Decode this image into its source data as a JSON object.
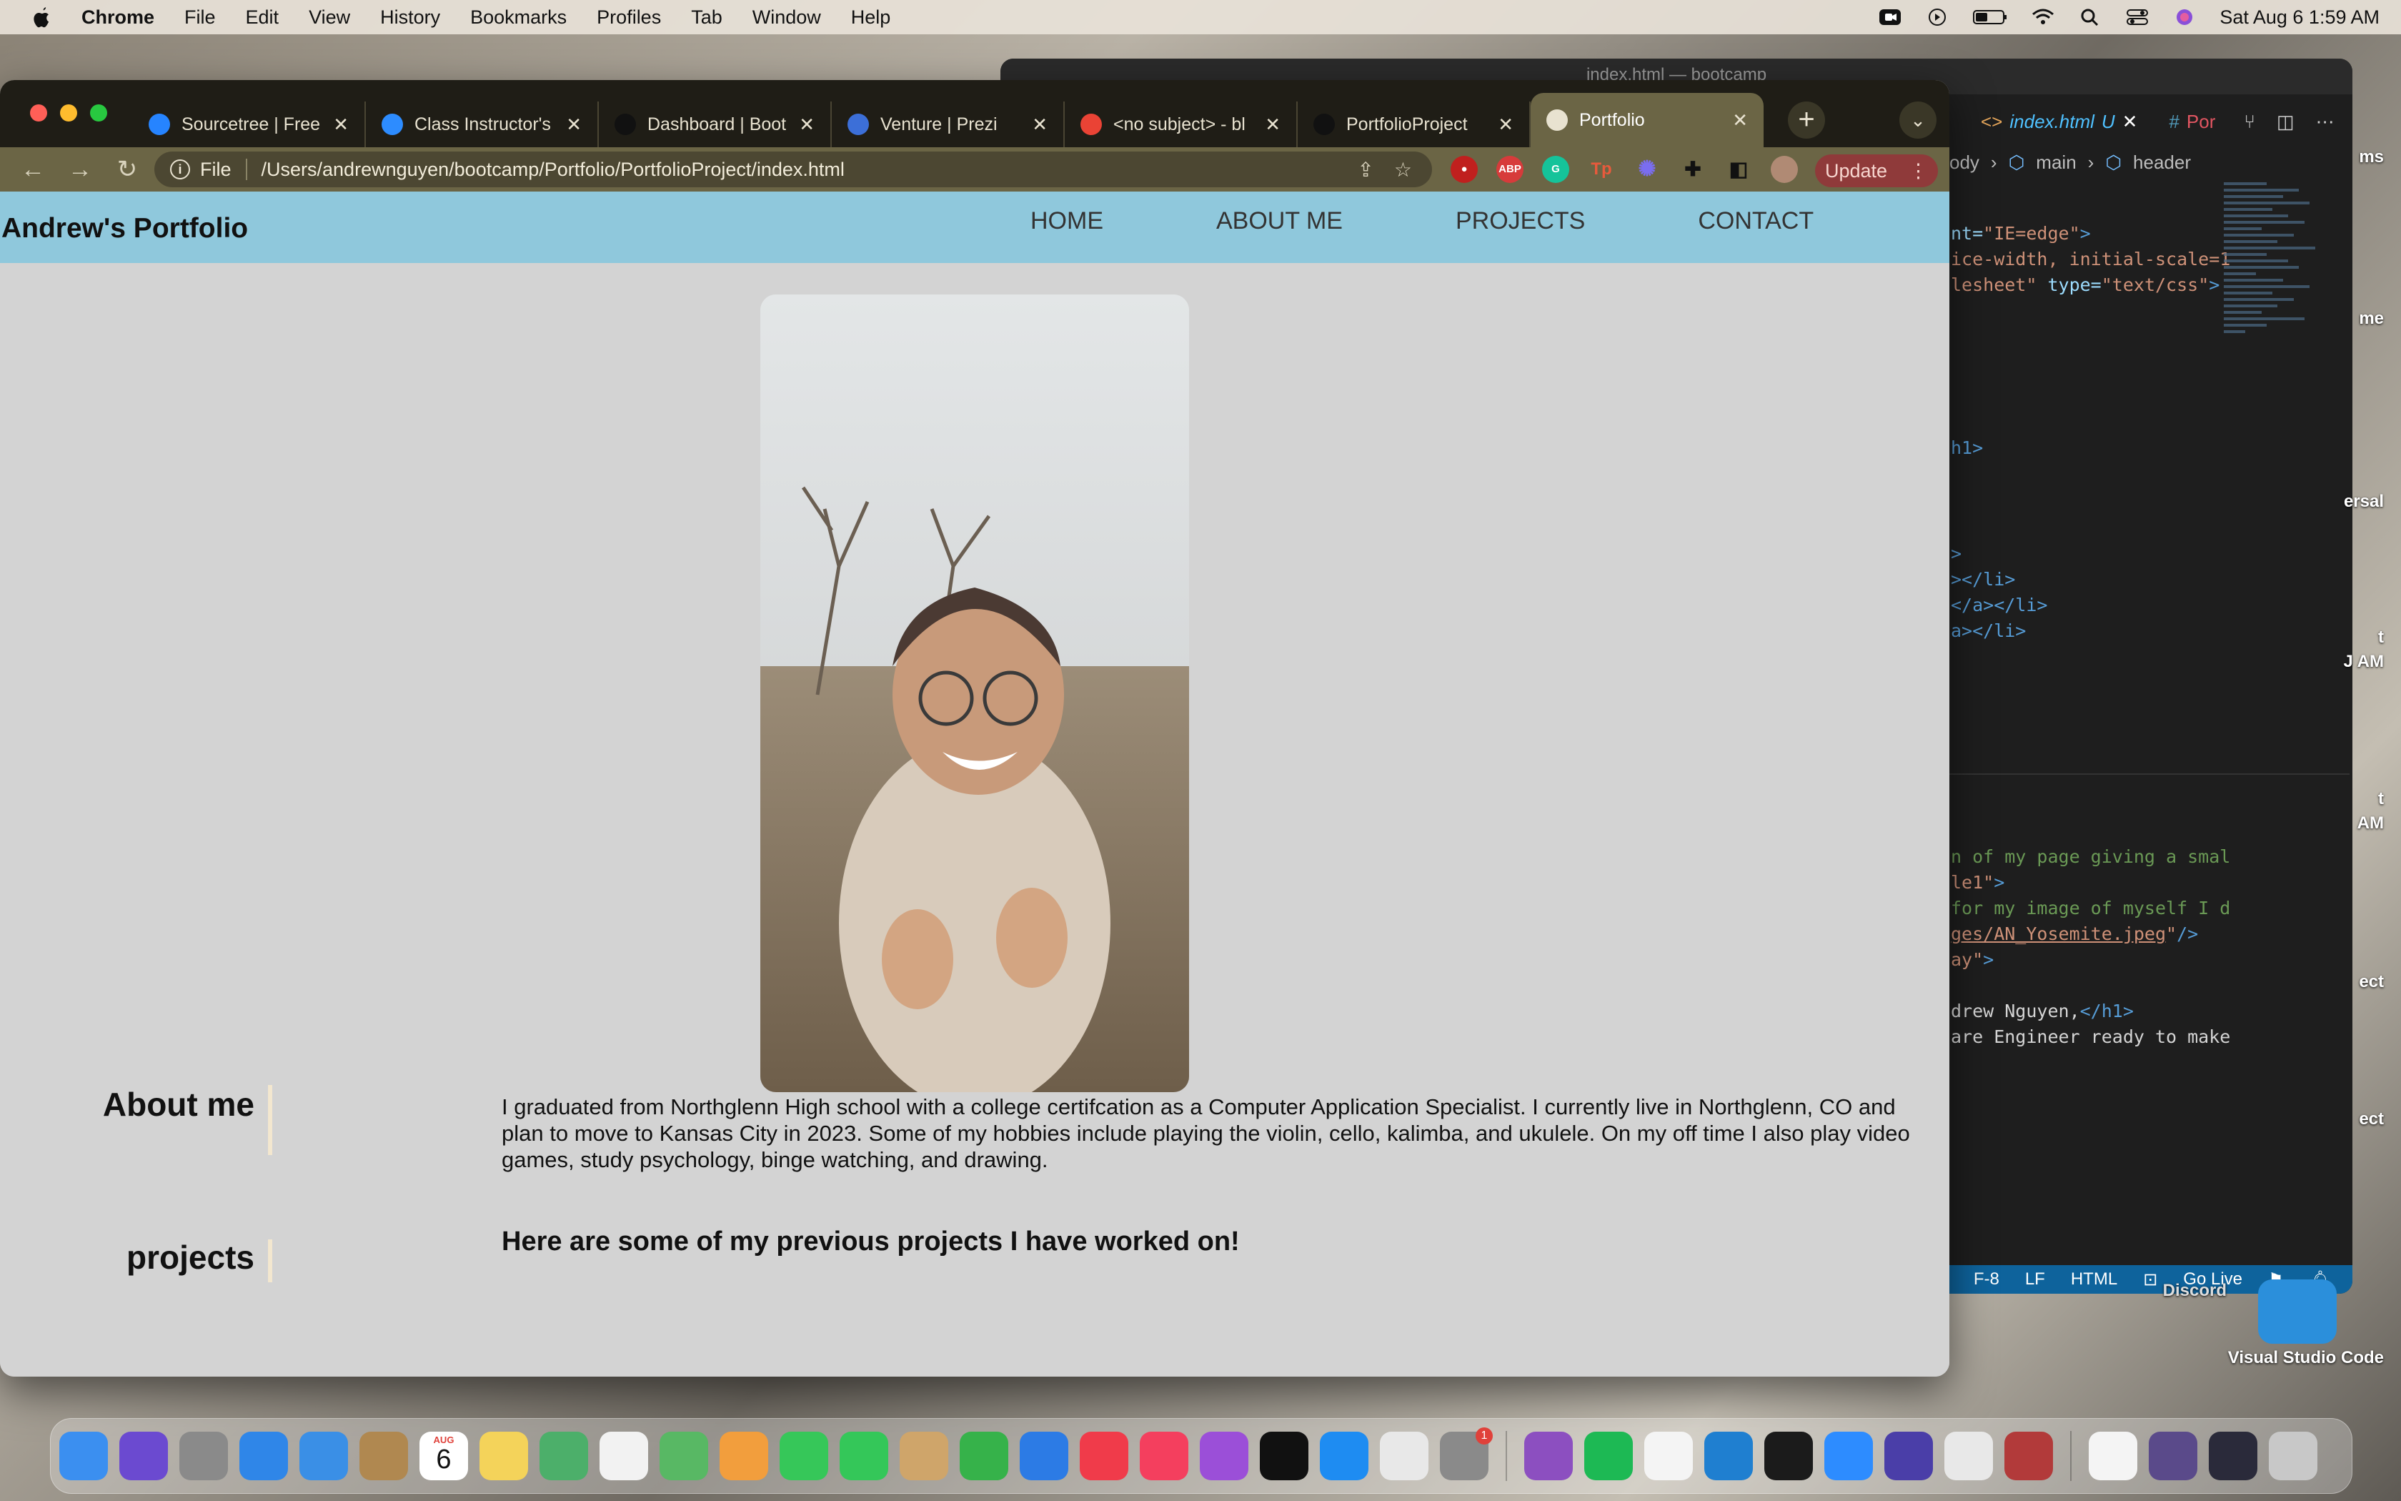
{
  "menubar": {
    "app_name": "Chrome",
    "items": [
      "File",
      "Edit",
      "View",
      "History",
      "Bookmarks",
      "Profiles",
      "Tab",
      "Window",
      "Help"
    ],
    "datetime": "Sat Aug 6  1:59 AM"
  },
  "vscode": {
    "window_title": "index.html — bootcamp",
    "tabs": [
      {
        "icon": "<>",
        "label": "index.html",
        "status": "U"
      },
      {
        "icon": "#",
        "label": "Por"
      }
    ],
    "breadcrumb": [
      "ody",
      "main",
      "header"
    ],
    "code_lines": [
      {
        "parts": [
          {
            "c": "c-attr",
            "t": "nt="
          },
          {
            "c": "c-str",
            "t": "\"IE=edge\""
          },
          {
            "c": "c-tag",
            "t": ">"
          }
        ]
      },
      {
        "parts": [
          {
            "c": "c-str",
            "t": "ice-width, initial-scale=1"
          }
        ]
      },
      {
        "parts": [
          {
            "c": "c-str",
            "t": "lesheet\""
          },
          {
            "c": "c-attr",
            "t": " type="
          },
          {
            "c": "c-str",
            "t": "\"text/css\""
          },
          {
            "c": "c-tag",
            "t": ">"
          }
        ]
      },
      {
        "parts": [
          {
            "c": "c-tag",
            "t": "h1>"
          }
        ]
      },
      {
        "parts": [
          {
            "c": "c-tag",
            "t": ">"
          }
        ]
      },
      {
        "parts": [
          {
            "c": "c-tag",
            "t": "></li>"
          }
        ]
      },
      {
        "parts": [
          {
            "c": "c-tag",
            "t": "</a></li>"
          }
        ]
      },
      {
        "parts": [
          {
            "c": "c-tag",
            "t": "a></li>"
          }
        ]
      },
      {
        "parts": [
          {
            "c": "c-com",
            "t": "n of my page giving a smal"
          }
        ]
      },
      {
        "parts": [
          {
            "c": "c-str",
            "t": "le1\""
          },
          {
            "c": "c-tag",
            "t": ">"
          }
        ]
      },
      {
        "parts": [
          {
            "c": "c-com",
            "t": "for my image of myself I d"
          }
        ]
      },
      {
        "parts": [
          {
            "c": "c-str u",
            "t": "ges/AN_Yosemite.jpeg"
          },
          {
            "c": "c-str",
            "t": "\""
          },
          {
            "c": "c-tag",
            "t": "/>"
          }
        ]
      },
      {
        "parts": [
          {
            "c": "c-str",
            "t": "ay\""
          },
          {
            "c": "c-tag",
            "t": ">"
          }
        ]
      },
      {
        "parts": [
          {
            "c": "c-txt",
            "t": "drew Nguyen,"
          },
          {
            "c": "c-tag",
            "t": "</h1>"
          }
        ]
      },
      {
        "parts": [
          {
            "c": "c-txt",
            "t": "are Engineer ready to make"
          }
        ]
      }
    ],
    "statusbar": [
      "F-8",
      "LF",
      "HTML",
      "Go Live"
    ]
  },
  "desktop_labels": [
    "ms",
    "me",
    "ersal",
    "t",
    "J AM",
    "t",
    "AM",
    "ect",
    "ect",
    "Discord",
    "Visual Studio Code"
  ],
  "chrome": {
    "tabs": [
      {
        "label": "Sourcetree | Free",
        "icon": "sourcetree-icon",
        "color": "#2684ff"
      },
      {
        "label": "Class Instructor's",
        "icon": "zoom-icon",
        "color": "#2d8cff"
      },
      {
        "label": "Dashboard | Boot",
        "icon": "github-icon",
        "color": "#111111"
      },
      {
        "label": "Venture | Prezi",
        "icon": "prezi-icon",
        "color": "#3c6fd8"
      },
      {
        "label": "<no subject> - bl",
        "icon": "gmail-icon",
        "color": "#ea4335"
      },
      {
        "label": "PortfolioProject",
        "icon": "github-icon",
        "color": "#111111"
      },
      {
        "label": "Portfolio",
        "icon": "globe-icon",
        "color": "#e8e2d0",
        "active": true
      }
    ],
    "omnibox": {
      "scheme": "File",
      "url": "/Users/andrewnguyen/bootcamp/Portfolio/PortfolioProject/index.html"
    },
    "update_label": "Update"
  },
  "site": {
    "title": "Andrew's Portfolio",
    "nav": [
      "HOME",
      "ABOUT ME",
      "PROJECTS",
      "CONTACT"
    ],
    "about_title": "About me",
    "about_text": "I graduated from Northglenn High school with a college certifcation as a Computer Application Specialist. I currently live in Northglenn, CO and plan to move to Kansas City in 2023. Some of my hobbies include playing the violin, cello, kalimba, and ukulele. On my off time I also play video games, study psychology, binge watching, and drawing.",
    "projects_title": "projects",
    "projects_intro": "Here are some of my previous projects I have worked on!"
  },
  "dock": {
    "calendar_month": "AUG",
    "calendar_day": "6",
    "settings_badge": "1",
    "apps": [
      {
        "name": "finder",
        "color": "#3b8ff0"
      },
      {
        "name": "siri",
        "color": "#6b4ad0"
      },
      {
        "name": "launchpad",
        "color": "#8a8a8a"
      },
      {
        "name": "safari",
        "color": "#2f86e8"
      },
      {
        "name": "mail",
        "color": "#3a8fe6"
      },
      {
        "name": "contacts",
        "color": "#b08850"
      },
      {
        "name": "calendar",
        "color": "#ffffff"
      },
      {
        "name": "notes",
        "color": "#f4d35a"
      },
      {
        "name": "atom",
        "color": "#4caf6a"
      },
      {
        "name": "reminders",
        "color": "#f2f2f2"
      },
      {
        "name": "maps",
        "color": "#58b864"
      },
      {
        "name": "photos",
        "color": "#f29e3d"
      },
      {
        "name": "messages",
        "color": "#36c759"
      },
      {
        "name": "facetime",
        "color": "#34c759"
      },
      {
        "name": "preview",
        "color": "#cfa56a"
      },
      {
        "name": "numbers",
        "color": "#36b24a"
      },
      {
        "name": "keynote",
        "color": "#2c7be5"
      },
      {
        "name": "news",
        "color": "#f03b4a"
      },
      {
        "name": "music",
        "color": "#f43f5e"
      },
      {
        "name": "podcasts",
        "color": "#9b4fd8"
      },
      {
        "name": "apple-tv",
        "color": "#111111"
      },
      {
        "name": "app-store",
        "color": "#1e8cf2"
      },
      {
        "name": "chrome",
        "color": "#e8e8e8"
      },
      {
        "name": "system-preferences",
        "color": "#8a8a8a"
      },
      {
        "name": "separator"
      },
      {
        "name": "potion-app",
        "color": "#8c4fc0"
      },
      {
        "name": "spotify",
        "color": "#1db954"
      },
      {
        "name": "slack",
        "color": "#f4f4f4"
      },
      {
        "name": "vscode",
        "color": "#1f7fd0"
      },
      {
        "name": "terminal",
        "color": "#1b1b1b"
      },
      {
        "name": "zoom",
        "color": "#2d8cff"
      },
      {
        "name": "moon-app",
        "color": "#4a3ea8"
      },
      {
        "name": "chrome-alt",
        "color": "#e8e8e8"
      },
      {
        "name": "dictionary",
        "color": "#b23a3a"
      },
      {
        "name": "separator"
      },
      {
        "name": "document",
        "color": "#f4f4f4"
      },
      {
        "name": "image-stack",
        "color": "#5a4a8a"
      },
      {
        "name": "screenshot",
        "color": "#2a2a3a"
      },
      {
        "name": "trash",
        "color": "#c8c8c8"
      }
    ]
  }
}
